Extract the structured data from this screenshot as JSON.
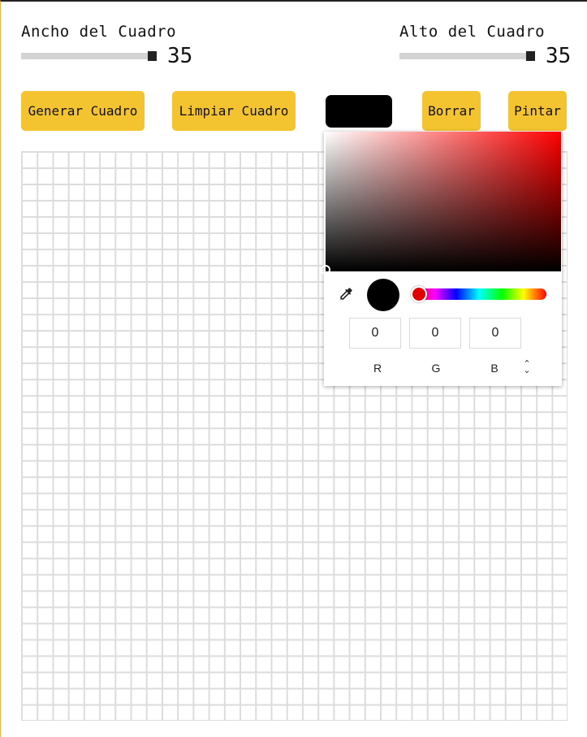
{
  "width_control": {
    "label": "Ancho del Cuadro",
    "value": "35",
    "level": 1.0
  },
  "height_control": {
    "label": "Alto del Cuadro",
    "value": "35",
    "level": 1.0
  },
  "buttons": {
    "generate": "Generar Cuadro",
    "clear": "Limpiar Cuadro",
    "erase": "Borrar",
    "paint": "Pintar"
  },
  "current_color": "#000000",
  "grid": {
    "columns": 35,
    "rows": 35
  },
  "color_picker": {
    "hue_color": "#ff0000",
    "r_value": "0",
    "g_value": "0",
    "b_value": "0",
    "r_label": "R",
    "g_label": "G",
    "b_label": "B",
    "eyedropper_icon": "eyedropper-icon",
    "mode_toggle_icon": "up-down-chevron-icon"
  },
  "colors": {
    "button_bg": "#f4c430",
    "grid_line": "#dcdcdc"
  }
}
